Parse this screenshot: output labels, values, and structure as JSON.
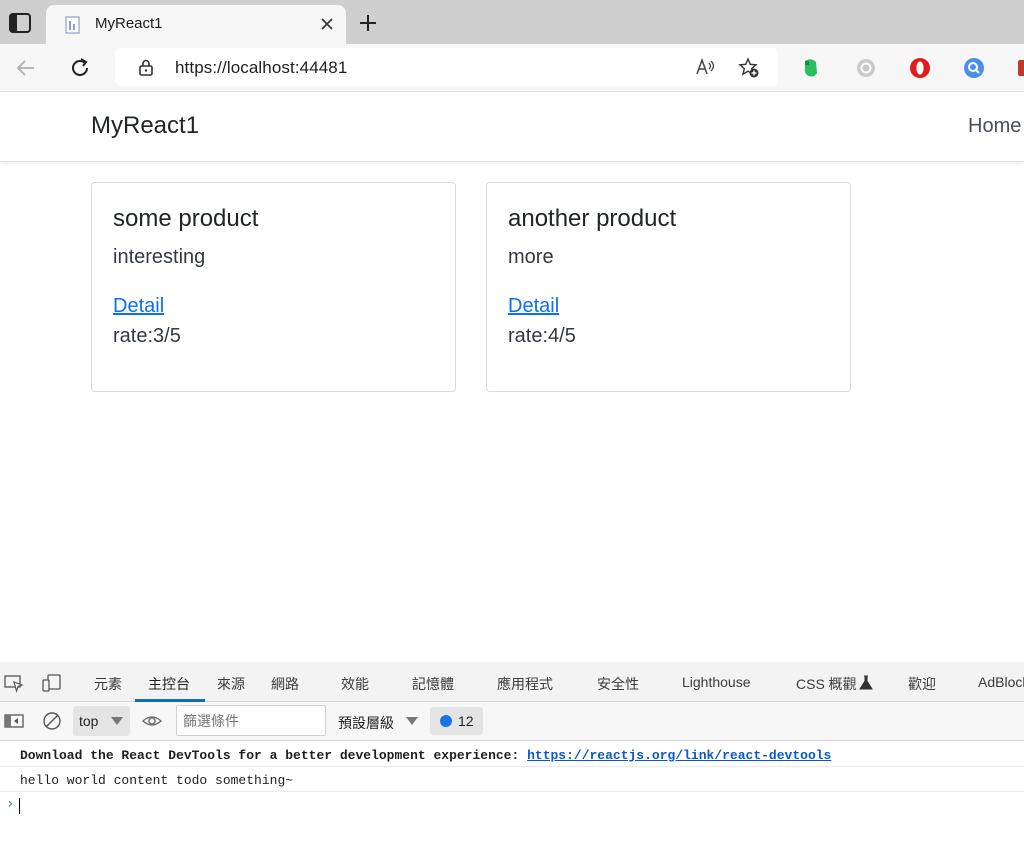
{
  "browser": {
    "tab": {
      "title": "MyReact1"
    },
    "address": {
      "url": "https://localhost:44481"
    },
    "icons": [
      "sidebar-icon",
      "page-favicon-icon",
      "close-icon",
      "plus-icon",
      "back-arrow-icon",
      "refresh-icon",
      "lock-icon",
      "read-aloud-icon",
      "add-favorite-icon",
      "evernote-extension-icon",
      "grey-extension-icon",
      "opera-extension-icon",
      "search-extension-icon",
      "red-extension-icon"
    ]
  },
  "app": {
    "brand": "MyReact1",
    "nav": {
      "home": "Home"
    },
    "products": [
      {
        "title": "some product",
        "description": "interesting",
        "link": "Detail",
        "rate": "rate:3/5"
      },
      {
        "title": "another product",
        "description": "more",
        "link": "Detail",
        "rate": "rate:4/5"
      }
    ]
  },
  "devtools": {
    "tabs": [
      "元素",
      "主控台",
      "來源",
      "網路",
      "效能",
      "記憶體",
      "應用程式",
      "安全性",
      "Lighthouse",
      "CSS 概觀",
      "歡迎",
      "AdBlock"
    ],
    "active_tab": "主控台",
    "console_bar": {
      "context": "top",
      "filter_placeholder": "篩選條件",
      "levels": "預設層級",
      "issues_count": "12"
    },
    "messages": {
      "m1_text": "Download the React DevTools for a better development experience: ",
      "m1_link": "https://reactjs.org/link/react-devtools",
      "m2_text": "hello world content todo something~"
    },
    "prompt": "›"
  },
  "colors": {
    "accent": "#0f6cbd",
    "link": "#0d6efd",
    "console_link": "#0b57d0"
  }
}
